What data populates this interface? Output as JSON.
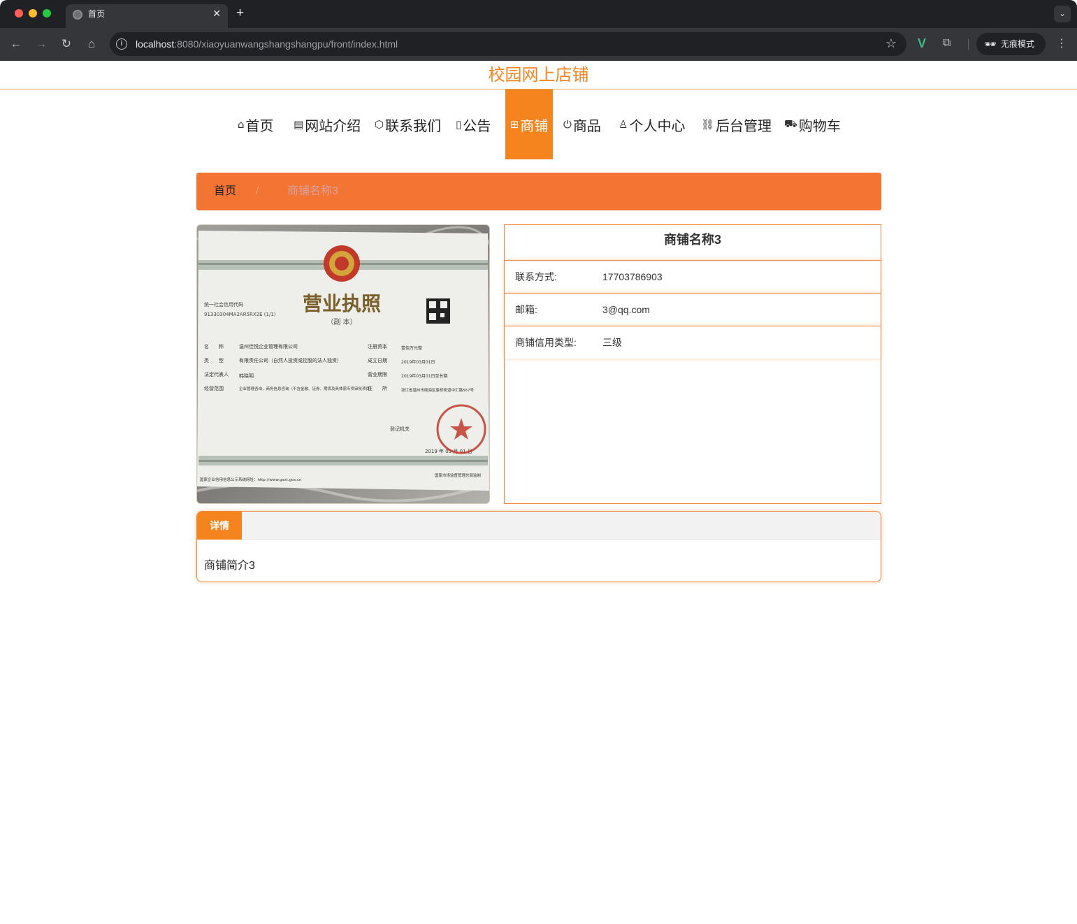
{
  "browser": {
    "tab_title": "首页",
    "url_host": "localhost",
    "url_path": ":8080/xiaoyuanwangshangshangpu/front/index.html",
    "incognito_label": "无痕模式"
  },
  "site": {
    "title": "校园网上店铺"
  },
  "nav": [
    {
      "icon": "⌂",
      "label": "首页"
    },
    {
      "icon": "▤",
      "label": "网站介绍"
    },
    {
      "icon": "⬡",
      "label": "联系我们"
    },
    {
      "icon": "▯",
      "label": "公告"
    },
    {
      "icon": "⊞",
      "label": "商铺"
    },
    {
      "icon": "⏻",
      "label": "商品"
    },
    {
      "icon": "♙",
      "label": "个人中心"
    },
    {
      "icon": "⛓",
      "label": "后台管理"
    },
    {
      "icon": "⛟",
      "label": "购物车"
    }
  ],
  "breadcrumb": {
    "home": "首页",
    "separator": "/",
    "current": "商铺名称3"
  },
  "shop": {
    "name": "商铺名称3",
    "rows": [
      {
        "label": "联系方式:",
        "value": "17703786903"
      },
      {
        "label": "邮箱:",
        "value": "3@qq.com"
      },
      {
        "label": "商铺信用类型:",
        "value": "三级"
      }
    ]
  },
  "license": {
    "heading": "营业执照",
    "subheading": "（副 本）",
    "code_label": "统一社会信用代码",
    "code": "91330304MA2AR5RX2E  (1/1)",
    "fields_left": [
      {
        "k": "名　　称",
        "v": "温州佳悦企业管理有限公司"
      },
      {
        "k": "类　　型",
        "v": "有限责任公司（自然人投资或控股的法人独资）"
      },
      {
        "k": "法定代表人",
        "v": "韩晓明"
      },
      {
        "k": "经营范围",
        "v": "企业管理咨询，商务信息咨询（不含金融、证券、期货及具体需专项审批项目）"
      }
    ],
    "fields_right": [
      {
        "k": "注册资本",
        "v": "壹佰万元整"
      },
      {
        "k": "成立日期",
        "v": "2019年03月01日"
      },
      {
        "k": "营业期限",
        "v": "2019年03月01日至长期"
      },
      {
        "k": "住　　所",
        "v": "浙江省温州市瓯海区娄桥街道中汇路567号"
      }
    ],
    "authority": "登记机关",
    "date": "2019 年 03 月 01 日",
    "footer_left": "国家企业信用信息公示系统网址：http://www.gsxt.gov.cn",
    "footer_right": "国家市场监督管理总局监制"
  },
  "detail": {
    "tab_label": "详情",
    "body": "商铺简介3"
  },
  "colors": {
    "accent": "#f5841f",
    "breadcrumb_bg": "#f47533"
  }
}
